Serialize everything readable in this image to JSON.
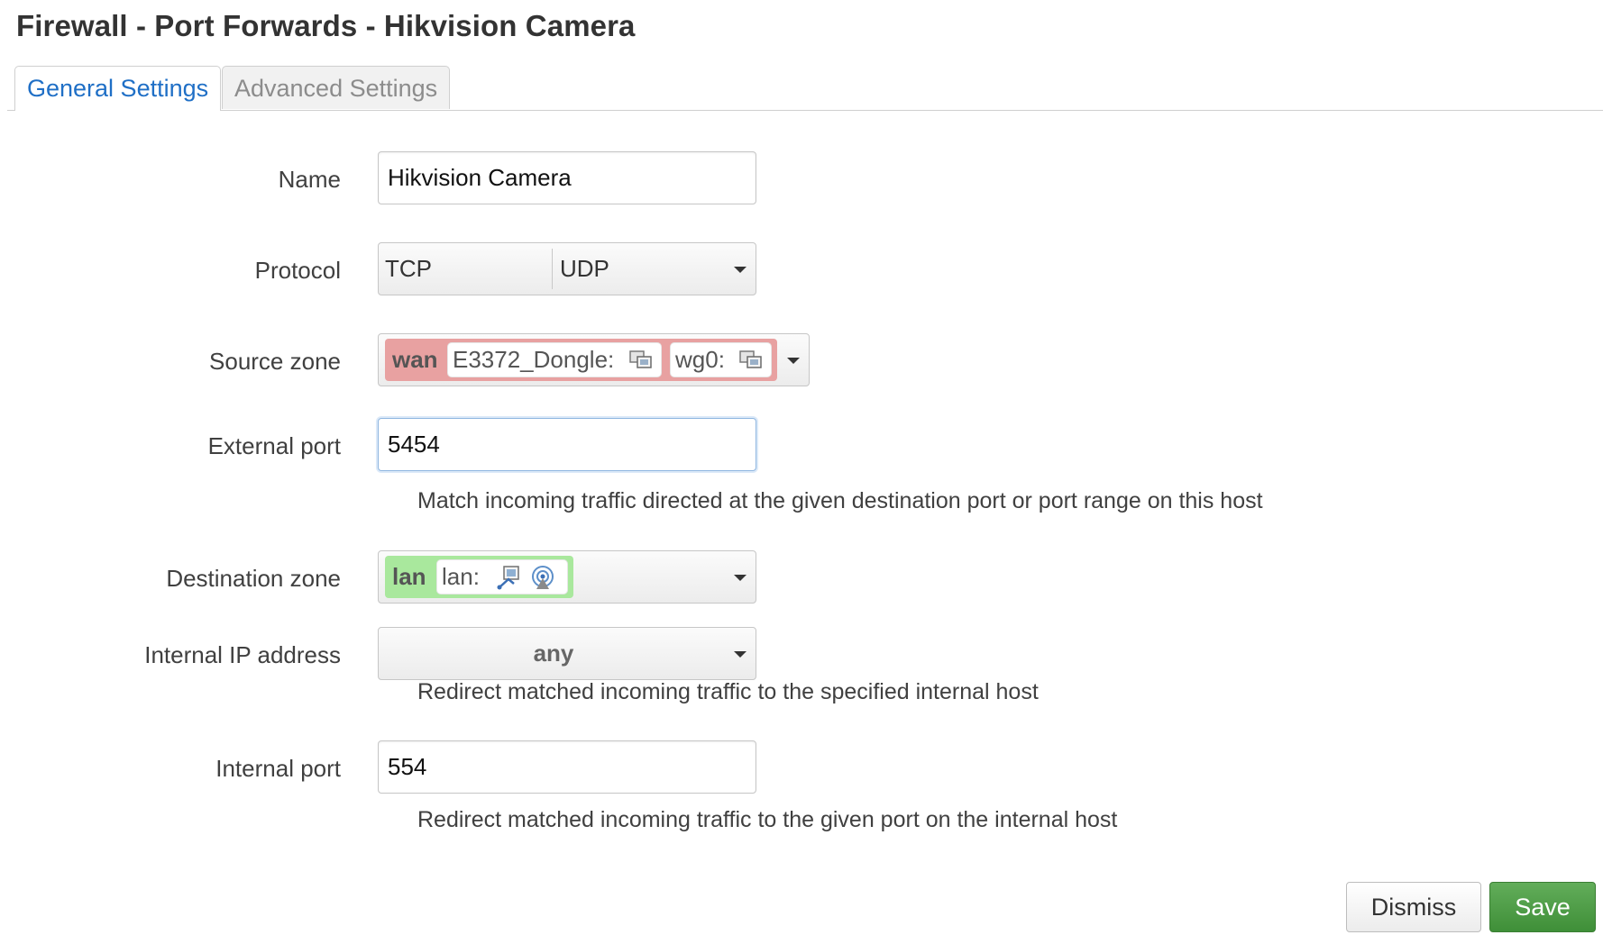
{
  "page": {
    "title": "Firewall - Port Forwards - Hikvision Camera"
  },
  "tabs": [
    {
      "label": "General Settings",
      "active": true
    },
    {
      "label": "Advanced Settings",
      "active": false
    }
  ],
  "form": {
    "name": {
      "label": "Name",
      "value": "Hikvision Camera"
    },
    "protocol": {
      "label": "Protocol",
      "selected": [
        "TCP",
        "UDP"
      ]
    },
    "source_zone": {
      "label": "Source zone",
      "zone": "wan",
      "zone_color": "#e8a1a1",
      "interfaces": [
        {
          "label": "E3372_Dongle:",
          "icon": "network-interface-icon"
        },
        {
          "label": "wg0:",
          "icon": "network-interface-icon"
        }
      ]
    },
    "external_port": {
      "label": "External port",
      "value": "5454",
      "help": "Match incoming traffic directed at the given destination port or port range on this host"
    },
    "destination_zone": {
      "label": "Destination zone",
      "zone": "lan",
      "zone_color": "#a9e89d",
      "interfaces": [
        {
          "label": "lan:",
          "icons": [
            "ethernet-port-icon",
            "wireless-icon"
          ]
        }
      ]
    },
    "internal_ip": {
      "label": "Internal IP address",
      "value": "any",
      "help": "Redirect matched incoming traffic to the specified internal host"
    },
    "internal_port": {
      "label": "Internal port",
      "value": "554",
      "help": "Redirect matched incoming traffic to the given port on the internal host"
    }
  },
  "actions": {
    "dismiss_label": "Dismiss",
    "save_label": "Save"
  },
  "colors": {
    "link_blue": "#1f6fc6",
    "save_green": "#4a9a42"
  }
}
